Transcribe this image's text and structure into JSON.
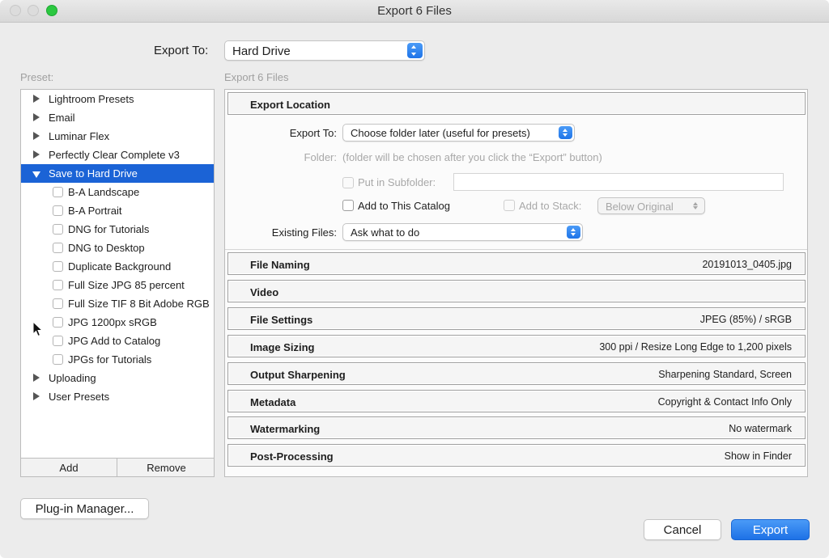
{
  "window": {
    "title": "Export 6 Files"
  },
  "export_to": {
    "label": "Export To:",
    "value": "Hard Drive"
  },
  "preset": {
    "heading": "Preset:",
    "groups": [
      {
        "label": "Lightroom Presets",
        "expanded": false
      },
      {
        "label": "Email",
        "expanded": false
      },
      {
        "label": "Luminar Flex",
        "expanded": false
      },
      {
        "label": "Perfectly Clear Complete v3",
        "expanded": false
      },
      {
        "label": "Save to Hard Drive",
        "expanded": true,
        "selected": true
      },
      {
        "label": "Uploading",
        "expanded": false
      },
      {
        "label": "User Presets",
        "expanded": false
      }
    ],
    "children": [
      "B-A Landscape",
      "B-A Portrait",
      "DNG for Tutorials",
      "DNG to Desktop",
      "Duplicate Background",
      "Full Size JPG 85 percent",
      "Full Size TIF 8 Bit Adobe RGB",
      "JPG 1200px sRGB",
      "JPG Add to Catalog",
      "JPGs for Tutorials"
    ],
    "add_label": "Add",
    "remove_label": "Remove"
  },
  "right": {
    "heading": "Export 6 Files",
    "export_location": {
      "title": "Export Location",
      "export_to_label": "Export To:",
      "export_to_value": "Choose folder later (useful for presets)",
      "folder_label": "Folder:",
      "folder_value": "(folder will be chosen after you click the “Export” button)",
      "subfolder_label": "Put in Subfolder:",
      "subfolder_value": "",
      "add_catalog_label": "Add to This Catalog",
      "add_stack_label": "Add to Stack:",
      "stack_value": "Below Original",
      "existing_label": "Existing Files:",
      "existing_value": "Ask what to do"
    },
    "sections": [
      {
        "title": "File Naming",
        "summary": "20191013_0405.jpg"
      },
      {
        "title": "Video",
        "summary": ""
      },
      {
        "title": "File Settings",
        "summary": "JPEG (85%) / sRGB"
      },
      {
        "title": "Image Sizing",
        "summary": "300 ppi / Resize Long Edge to 1,200 pixels"
      },
      {
        "title": "Output Sharpening",
        "summary": "Sharpening Standard, Screen"
      },
      {
        "title": "Metadata",
        "summary": "Copyright & Contact Info Only"
      },
      {
        "title": "Watermarking",
        "summary": "No watermark"
      },
      {
        "title": "Post-Processing",
        "summary": "Show in Finder"
      }
    ]
  },
  "buttons": {
    "plugin_manager": "Plug-in Manager...",
    "cancel": "Cancel",
    "export": "Export"
  },
  "colors": {
    "accent": "#1b63d6",
    "primary_button": "#2a7cf0",
    "disabled_text": "#a8a8a8"
  }
}
